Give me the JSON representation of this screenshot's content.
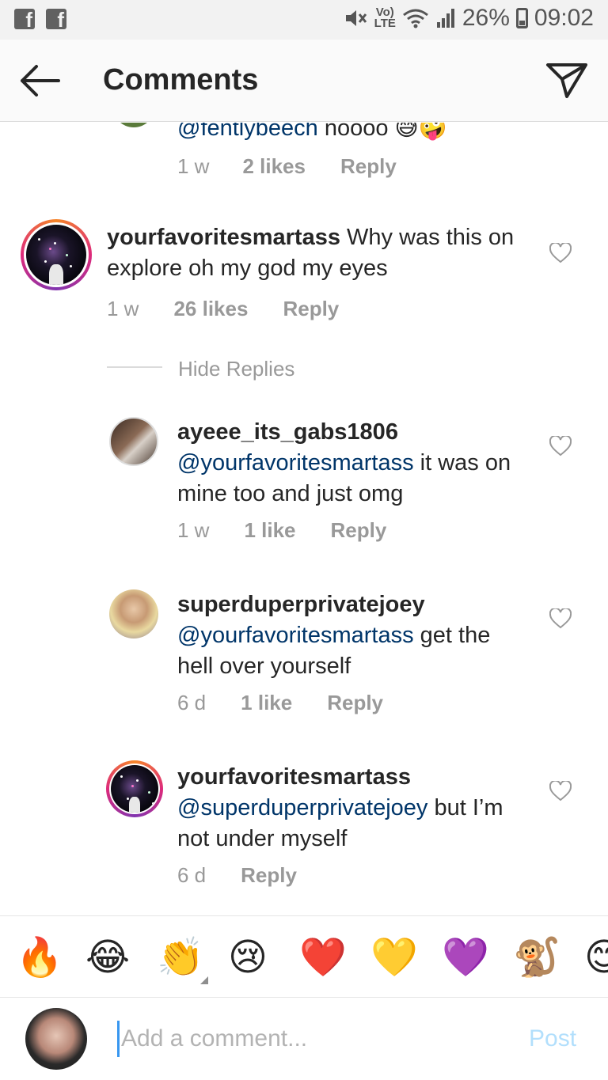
{
  "status_bar": {
    "battery": "26%",
    "time": "09:02",
    "network_top": "Vo)",
    "network_bottom": "LTE"
  },
  "header": {
    "title": "Comments"
  },
  "comments": [
    {
      "text_mention": "@fentlybeech",
      "text": " noooo 😅🤪",
      "time": "1 w",
      "likes": "2 likes",
      "reply": "Reply"
    },
    {
      "username": "yourfavoritesmartass",
      "text": " Why was this on explore oh my god my eyes",
      "time": "1 w",
      "likes": "26 likes",
      "reply": "Reply",
      "hide_replies": "Hide Replies"
    },
    {
      "username": "ayeee_its_gabs1806",
      "mention": "@yourfavoritesmartass",
      "text": " it was on mine too and just omg",
      "time": "1 w",
      "likes": "1 like",
      "reply": "Reply"
    },
    {
      "username": "superduperprivatejoey",
      "mention": "@yourfavoritesmartass",
      "text": " get the hell over yourself",
      "time": "6 d",
      "likes": "1 like",
      "reply": "Reply"
    },
    {
      "username": "yourfavoritesmartass",
      "mention": "@superduperprivatejoey",
      "text": " but I’m not under myself",
      "time": "6 d",
      "reply": "Reply"
    }
  ],
  "emoji_bar": [
    "🔥",
    "😂",
    "👏",
    "😢",
    "❤️",
    "💛",
    "💜",
    "🐒",
    "😊"
  ],
  "composer": {
    "placeholder": "Add a comment...",
    "post_label": "Post"
  },
  "colors": {
    "mention": "#003569",
    "meta": "#999999",
    "post_disabled": "#b2dffc"
  }
}
